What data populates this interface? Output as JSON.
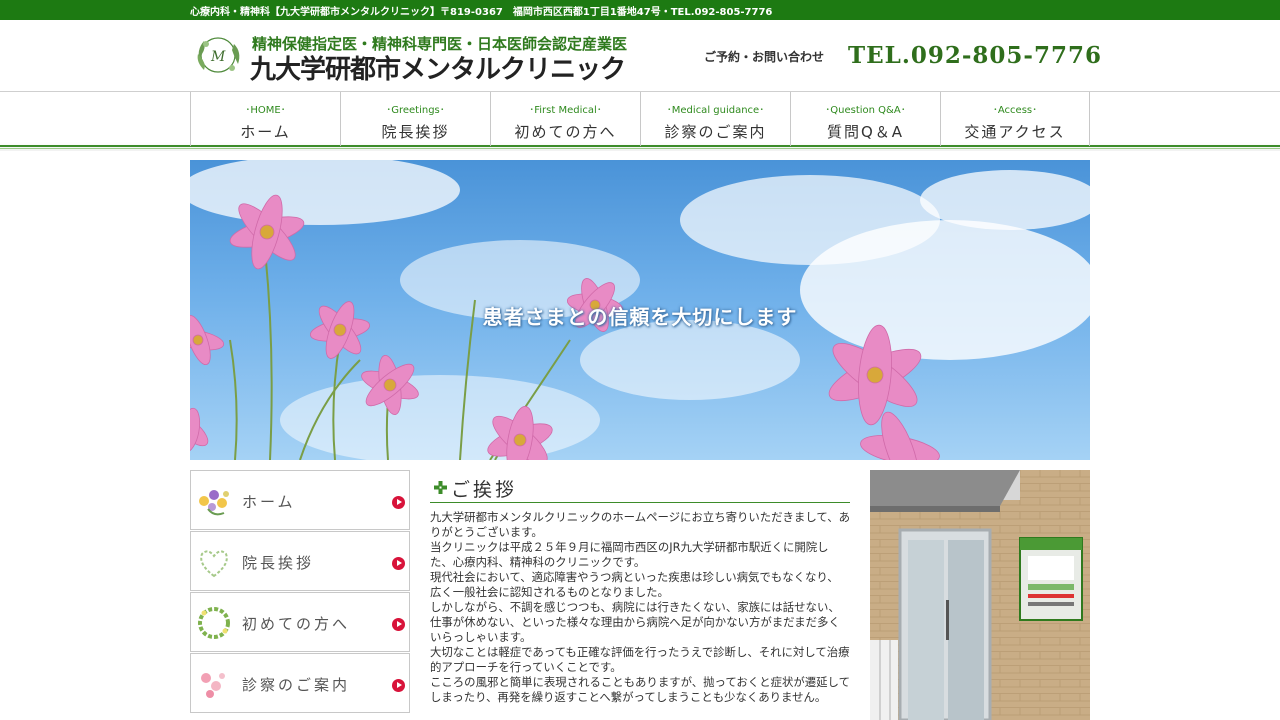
{
  "topbar": {
    "text": "心療内科・精神科【九大学研都市メンタルクリニック】〒819-0367　福岡市西区西都1丁目1番地47号・TEL.092-805-7776"
  },
  "header": {
    "logo_subtitle": "精神保健指定医・精神科専門医・日本医師会認定産業医",
    "logo_title": "九大学研都市メンタルクリニック",
    "contact_label": "ご予約・お問い合わせ",
    "contact_tel": "TEL.092-805-7776"
  },
  "nav": [
    {
      "en": "･HOME･",
      "jp": "ホーム"
    },
    {
      "en": "･Greetings･",
      "jp": "院長挨拶"
    },
    {
      "en": "･First Medical･",
      "jp": "初めての方へ"
    },
    {
      "en": "･Medical guidance･",
      "jp": "診察のご案内"
    },
    {
      "en": "･Question Q&A･",
      "jp": "質問Q＆A"
    },
    {
      "en": "･Access･",
      "jp": "交通アクセス"
    }
  ],
  "hero": {
    "title": "患者さまとの信頼を大切にします"
  },
  "sidebar": {
    "items": [
      {
        "label": "ホーム",
        "icon": "flower-bouquet-icon"
      },
      {
        "label": "院長挨拶",
        "icon": "heart-wreath-icon"
      },
      {
        "label": "初めての方へ",
        "icon": "flower-wreath-icon"
      },
      {
        "label": "診察のご案内",
        "icon": "pink-flowers-icon"
      }
    ],
    "arrow_color": "#d8133a"
  },
  "greeting": {
    "title": "ご挨拶",
    "paragraphs": [
      "九大学研都市メンタルクリニックのホームページにお立ち寄りいただきまして、ありがとうございます。",
      "当クリニックは平成２５年９月に福岡市西区のJR九大学研都市駅近くに開院した、心療内科、精神科のクリニックです。",
      "現代社会において、適応障害やうつ病といった疾患は珍しい病気でもなくなり、広く一般社会に認知されるものとなりました。",
      "しかしながら、不調を感じつつも、病院には行きたくない、家族には話せない、仕事が休めない、といった様々な理由から病院へ足が向かない方がまだまだ多くいらっしゃいます。",
      "大切なことは軽症であっても正確な評価を行ったうえで診断し、それに対して治療的アプローチを行っていくことです。",
      "こころの風邪と簡単に表現されることもありますが、抛っておくと症状が遷延してしまったり、再発を繰り返すことへ繋がってしまうことも少なくありません。"
    ]
  },
  "colors": {
    "brand_green": "#1d7a12",
    "accent_red": "#d8133a"
  }
}
